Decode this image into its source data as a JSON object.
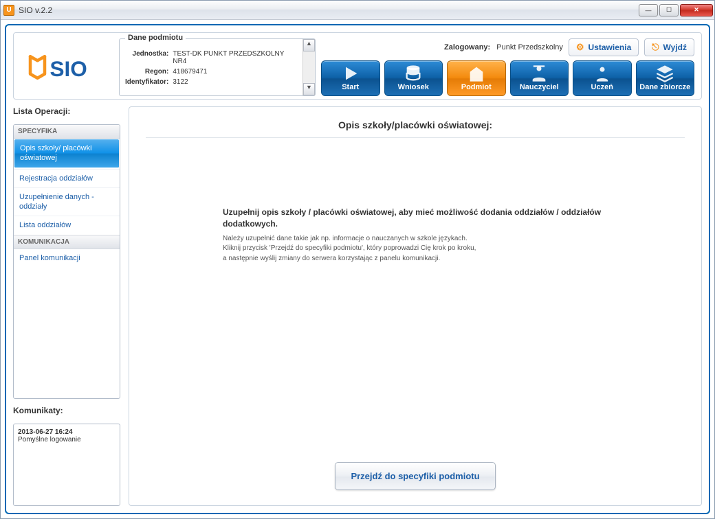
{
  "window": {
    "title": "SIO v.2.2"
  },
  "header": {
    "logo_text": "SIO",
    "details_legend": "Dane podmiotu",
    "fields": {
      "jednostka_k": "Jednostka:",
      "jednostka_v": "TEST-DK PUNKT PRZEDSZKOLNY NR4",
      "regon_k": "Regon:",
      "regon_v": "418679471",
      "ident_k": "Identyfikator:",
      "ident_v": "3122"
    },
    "logged_label": "Zalogowany:",
    "logged_user": "Punkt Przedszkolny",
    "settings_label": "Ustawienia",
    "logout_label": "Wyjdź"
  },
  "tiles": {
    "start": "Start",
    "wniosek": "Wniosek",
    "podmiot": "Podmiot",
    "nauczyciel": "Nauczyciel",
    "uczen": "Uczeń",
    "zbiorcze": "Dane zbiorcze"
  },
  "sidebar": {
    "title": "Lista Operacji:",
    "sections": {
      "specyfika": "SPECYFIKA",
      "komunikacja": "KOMUNIKACJA"
    },
    "items": {
      "opis": "Opis szkoły/ placówki oświatowej",
      "rejestracja": "Rejestracja oddziałów",
      "uzup": "Uzupełnienie danych - oddziały",
      "lista": "Lista oddziałów",
      "panel": "Panel komunikacji"
    }
  },
  "komunikaty": {
    "title": "Komunikaty:",
    "ts": "2013-06-27 16:24",
    "text": "Pomyślne logowanie"
  },
  "content": {
    "heading": "Opis szkoły/placówki oświatowej:",
    "msg_heading": "Uzupełnij opis szkoły / placówki oświatowej, aby mieć możliwość dodania oddziałów / oddziałów dodatkowych.",
    "msg_l1": "Należy uzupełnić dane takie jak np. informacje o nauczanych w szkole językach.",
    "msg_l2": "Kliknij przycisk 'Przejdź do specyfiki podmiotu', który poprowadzi Cię krok po kroku,",
    "msg_l3": "a następnie wyślij zmiany do serwera korzystając z panelu komunikacji.",
    "action_label": "Przejdź do specyfiki podmiotu"
  }
}
